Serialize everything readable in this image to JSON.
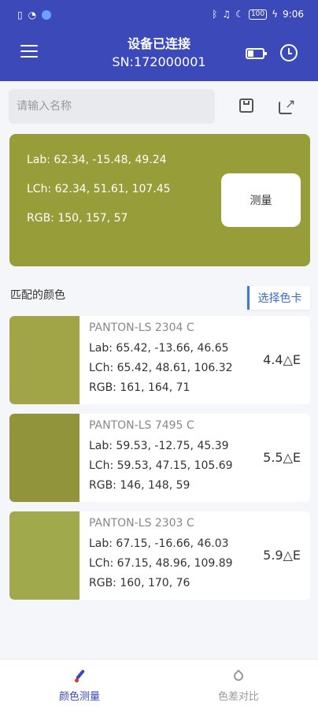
{
  "status_bar": {
    "battery": "100",
    "time": "9:06"
  },
  "header": {
    "title": "设备已连接",
    "serial": "SN:172000001"
  },
  "search": {
    "placeholder": "请输入名称",
    "value": ""
  },
  "measurement": {
    "lab": "Lab: 62.34, -15.48, 49.24",
    "lch": "LCh: 62.34, 51.61, 107.45",
    "rgb": "RGB: 150, 157, 57",
    "swatch_color": "#969d39",
    "measure_button": "测量"
  },
  "matched": {
    "label": "匹配的颜色",
    "select_card_button": "选择色卡",
    "items": [
      {
        "name": "PANTON-LS 2304 C",
        "lab": "Lab: 65.42, -13.66, 46.65",
        "lch": "LCh: 65.42, 48.61, 106.32",
        "rgb": "RGB: 161, 164, 71",
        "delta": "4.4△E",
        "color": "#a1a447"
      },
      {
        "name": "PANTON-LS 7495 C",
        "lab": "Lab: 59.53, -12.75, 45.39",
        "lch": "LCh: 59.53, 47.15, 105.69",
        "rgb": "RGB: 146, 148, 59",
        "delta": "5.5△E",
        "color": "#92943b"
      },
      {
        "name": "PANTON-LS 2303 C",
        "lab": "Lab: 67.15, -16.66, 46.03",
        "lch": "LCh: 67.15, 48.96, 109.89",
        "rgb": "RGB: 160, 170, 76",
        "delta": "5.9△E",
        "color": "#a0aa4c"
      }
    ]
  },
  "bottom_nav": {
    "tabs": [
      {
        "label": "颜色测量",
        "active": true
      },
      {
        "label": "色差对比",
        "active": false
      }
    ]
  },
  "colors": {
    "primary": "#3b4ab8",
    "accent_blue": "#3a7bd5"
  }
}
